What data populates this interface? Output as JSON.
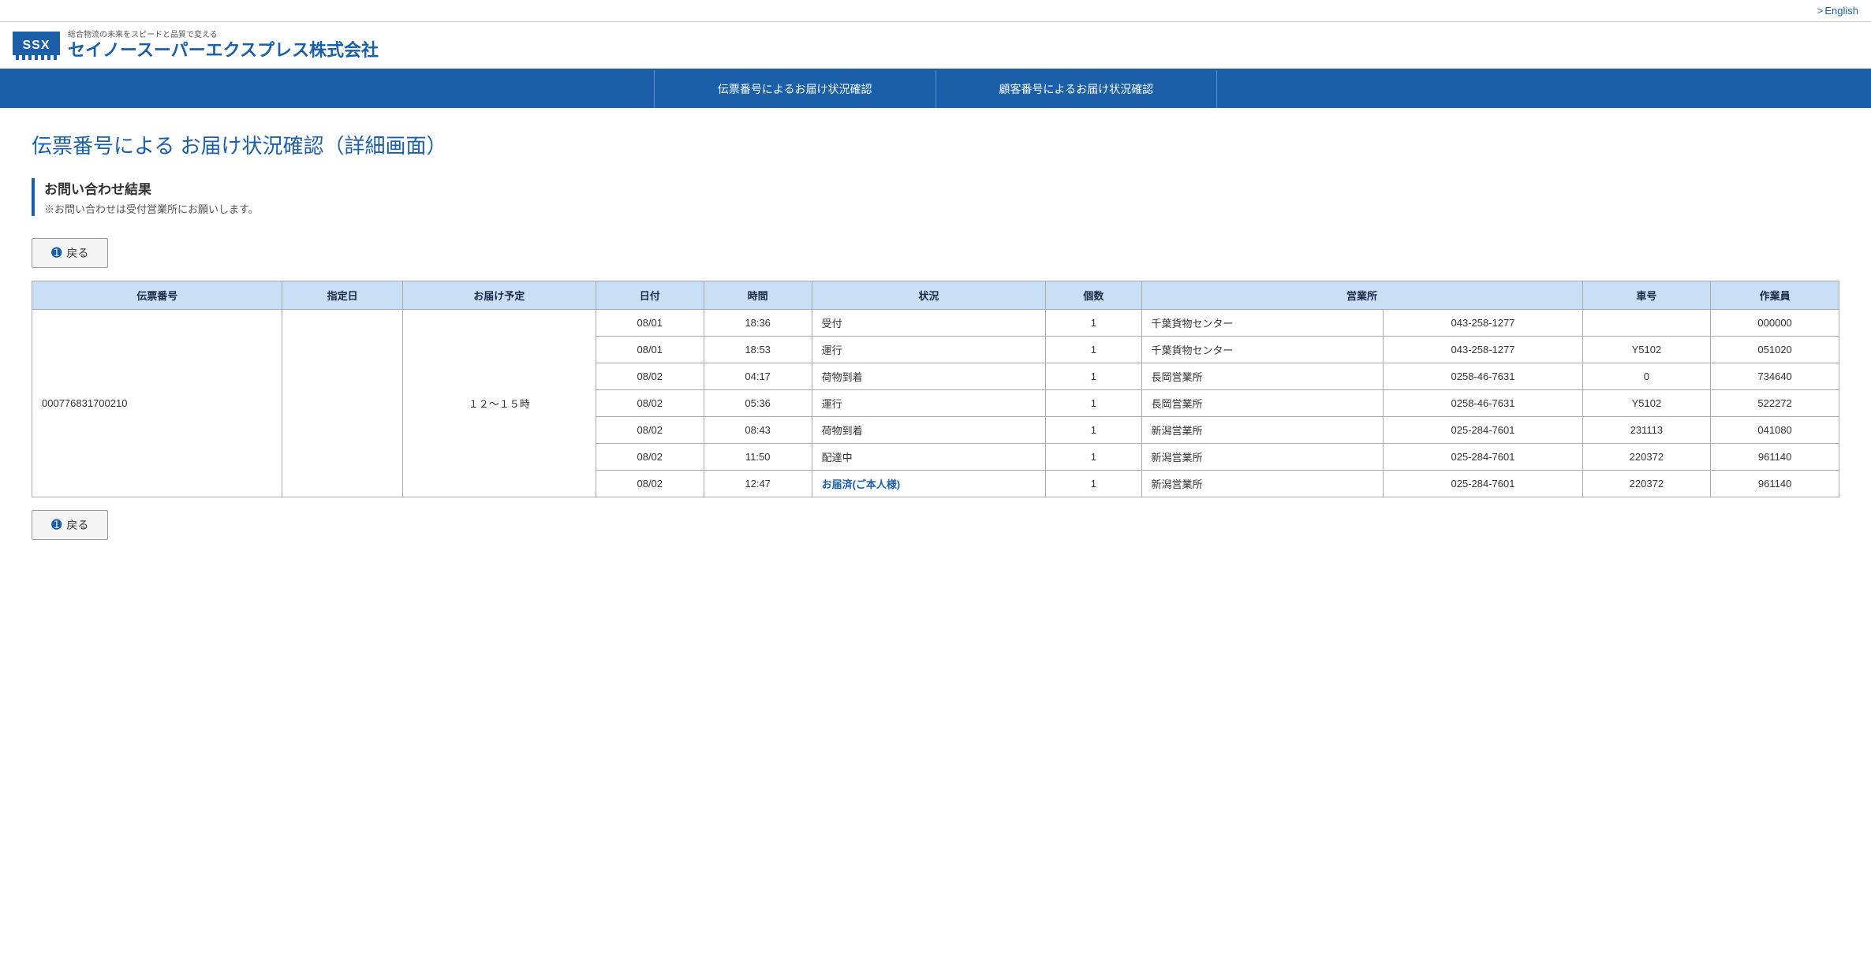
{
  "topbar": {
    "english_label": "English",
    "arrow": ">"
  },
  "header": {
    "logo_text": "SSX",
    "tagline": "総合物流の未来をスピードと品質で変える",
    "company_name": "セイノースーパーエクスプレス株式会社"
  },
  "nav": {
    "items": [
      {
        "label": "伝票番号によるお届け状況確認"
      },
      {
        "label": "顧客番号によるお届け状況確認"
      }
    ]
  },
  "page": {
    "title": "伝票番号による お届け状況確認（詳細画面）"
  },
  "info_box": {
    "heading": "お問い合わせ結果",
    "sub": "※お問い合わせは受付営業所にお願いします。"
  },
  "buttons": {
    "back_label": "戻る"
  },
  "table": {
    "headers": [
      "伝票番号",
      "指定日",
      "お届け予定",
      "日付",
      "時間",
      "状況",
      "個数",
      "営業所",
      "",
      "車号",
      "作業員"
    ],
    "tracking_number": "000776831700210",
    "delivery_time": "１２〜１５時",
    "rows": [
      {
        "date": "08/01",
        "time": "18:36",
        "status": "受付",
        "count": "1",
        "office": "千葉貨物センター",
        "phone": "043-258-1277",
        "car": "",
        "worker": "000000",
        "delivered": false
      },
      {
        "date": "08/01",
        "time": "18:53",
        "status": "運行",
        "count": "1",
        "office": "千葉貨物センター",
        "phone": "043-258-1277",
        "car": "Y5102",
        "worker": "051020",
        "delivered": false
      },
      {
        "date": "08/02",
        "time": "04:17",
        "status": "荷物到着",
        "count": "1",
        "office": "長岡営業所",
        "phone": "0258-46-7631",
        "car": "0",
        "worker": "734640",
        "delivered": false
      },
      {
        "date": "08/02",
        "time": "05:36",
        "status": "運行",
        "count": "1",
        "office": "長岡営業所",
        "phone": "0258-46-7631",
        "car": "Y5102",
        "worker": "522272",
        "delivered": false
      },
      {
        "date": "08/02",
        "time": "08:43",
        "status": "荷物到着",
        "count": "1",
        "office": "新潟営業所",
        "phone": "025-284-7601",
        "car": "231113",
        "worker": "041080",
        "delivered": false
      },
      {
        "date": "08/02",
        "time": "11:50",
        "status": "配達中",
        "count": "1",
        "office": "新潟営業所",
        "phone": "025-284-7601",
        "car": "220372",
        "worker": "961140",
        "delivered": false
      },
      {
        "date": "08/02",
        "time": "12:47",
        "status": "お届済(ご本人様)",
        "count": "1",
        "office": "新潟営業所",
        "phone": "025-284-7601",
        "car": "220372",
        "worker": "961140",
        "delivered": true
      }
    ]
  }
}
